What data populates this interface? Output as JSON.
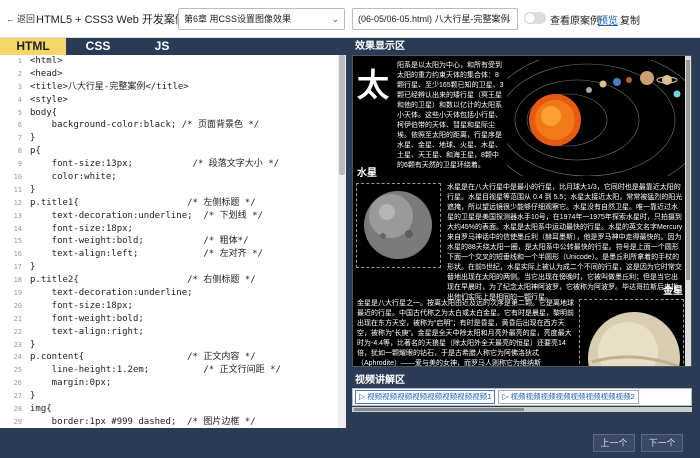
{
  "topbar": {
    "back_label": "返回",
    "app_title": "HTML5 + CSS3 Web 开发案例教程",
    "chapter_select": "第6章 用CSS设置图像效果",
    "case_select": "(06-05/06-05.html) 八大行星-完整案例",
    "toggle_label": "查看原案例",
    "preview_label": "预览",
    "copy_label": "复制"
  },
  "tabs": [
    "HTML",
    "CSS",
    "JS"
  ],
  "code_lines": [
    "<html>",
    "<head>",
    "<title>八大行星-完整案例</title>",
    "<style>",
    "body{",
    "    background-color:black; /* 页面背景色 */",
    "}",
    "p{",
    "    font-size:13px;           /* 段落文字大小 */",
    "    color:white;",
    "}",
    "p.title1{                    /* 左侧标题 */",
    "    text-decoration:underline;  /* 下划线 */",
    "    font-size:18px;",
    "    font-weight:bold;           /* 粗体*/",
    "    text-align:left;            /* 左对齐 */",
    "}",
    "p.title2{                    /* 右侧标题 */",
    "    text-decoration:underline;",
    "    font-size:18px;",
    "    font-weight:bold;",
    "    text-align:right;",
    "}",
    "p.content{                   /* 正文内容 */",
    "    line-height:1.2em;          /* 正文行间距 */",
    "    margin:0px;",
    "}",
    "img{",
    "    border:1px #999 dashed;  /* 图片边框 */",
    "}",
    "img.pic1{"
  ],
  "right": {
    "effect_title": "效果显示区",
    "video_title": "视频讲解区",
    "big_char": "太",
    "intro": "阳系是以太阳为中心，和所有受到太阳的重力约束天体的集合体：8颗行星、至少165颗已知的卫星、3颗已经辨认出来的矮行星（冥王星和他的卫星）和数以亿计的太阳系小天体。这些小天体包括小行星、柯伊伯带的天体、彗星和星际尘埃。依照至太阳的距离，行星序是水星、金星、地球、火星、木星、土星、天王星、和海王星，8颗中的6颗有天然的卫星环绕着。",
    "mercury_head": "水星",
    "mercury_text": "水星是在八大行星中是最小的行星，比月球大1/3，它同时也是最靠近太阳的行星。水星目视星等范围从 0.4 到 5.5；水星太接近太阳，常常被猛烈的阳光遮掩，所以望远镜很少能够仔细观察它。水星没有自然卫星。唯一靠近过水星的卫星是美国探测器水手10号，在1974年一1975年探索水星时，只拍摄到大约45%的表面。水星是太阳系中运动最快的行星。水星的英文名字Mercury来自罗马神话中的信使墨丘利（赫耳墨斯），他是罗马神中走得最快的。因为水星的88天绕太阳一圈，是太阳系中公转最快的行星。符号是上面一个圆形下面一个交叉的短垂线和一个半圆形（Unicode）。是墨丘利所拿着的手杖的形状。在前5世纪，水星实际上被认为成二个不同的行星，这是因为它时常交替地出现在太阳的两侧。当它出现在傍晚时，它被叫做墨丘利；但是当它出现在早晨时，为了纪念太阳神阿波罗，它被称为阿波罗。毕达哥拉斯后来指出他们实际上是相同的一颗行星。",
    "venus_head": "金星",
    "venus_text": "金星是八大行星之一。按离太阳由近及远的次序是第二颗。它是离地球最近的行星。中国古代称之为太白或太白金星。它有时是晨星，黎明前出现在东方天空，被称为“启明”；有时是昏星，黄昏后出现在西方天空，被称为“长庚”。金星是全天中除太阳和月亮外最亮的星，亮度最大时为-4.4等，比著名的天狼星（除太阳外全天最亮的恒星）还要亮14倍，犹如一颗耀眼的钻石，于是古希腊人称它为阿佛洛狄忒（Aphrodite）——爱与美的女神，而罗马人则称它为维纳斯",
    "videos": [
      "视频视频视频视频视频视频视频视频1",
      "视频视频视频视频视频视频视频视频2"
    ]
  },
  "bottom": {
    "prev_label": "上一个",
    "next_label": "下一个"
  },
  "colors": {
    "panel_bg": "#2b3a55",
    "active_tab": "#f5d66b",
    "link_blue": "#1a5fb4"
  }
}
